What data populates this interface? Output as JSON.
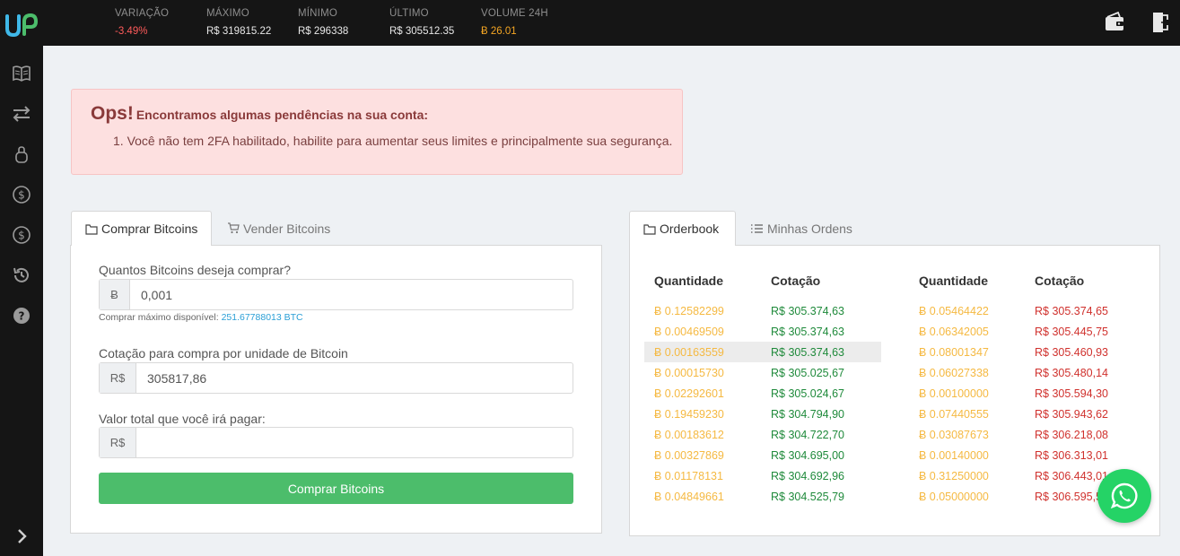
{
  "header": {
    "stats": [
      {
        "label": "VARIAÇÃO",
        "value": "-3.49%",
        "tone": "red"
      },
      {
        "label": "MÁXIMO",
        "value": "R$ 319815.22",
        "tone": "white"
      },
      {
        "label": "MÍNIMO",
        "value": "R$ 296338",
        "tone": "white"
      },
      {
        "label": "ÚLTIMO",
        "value": "R$ 305512.35",
        "tone": "white"
      },
      {
        "label": "VOLUME 24H",
        "value": "Ƀ 26.01",
        "tone": "orange"
      }
    ],
    "icons": [
      "wallet-icon",
      "logout-icon"
    ]
  },
  "sidebar": {
    "items": [
      "book-icon",
      "transfer-icon",
      "lock-icon",
      "dollar-circle-icon",
      "dollar-circle-icon",
      "history-icon",
      "help-icon"
    ],
    "expand": "chevron-right-icon"
  },
  "alert": {
    "title": "Ops!",
    "subtitle": "Encontramos algumas pendências na sua conta:",
    "items": [
      "1. Você não tem 2FA habilitado, habilite para aumentar seus limites e principalmente sua segurança."
    ]
  },
  "trade": {
    "tabs": [
      "Comprar Bitcoins",
      "Vender Bitcoins"
    ],
    "amount_label": "Quantos Bitcoins deseja comprar?",
    "amount_addon": "Ƀ",
    "amount_value": "0,001",
    "max_label": "Comprar máximo disponível:",
    "max_value": "251.67788013 BTC",
    "price_label": "Cotação para compra por unidade de Bitcoin",
    "price_addon": "R$",
    "price_value": "305817,86",
    "total_label": "Valor total que você irá pagar:",
    "total_addon": "R$",
    "total_value": "",
    "submit": "Comprar Bitcoins"
  },
  "orderbook": {
    "tabs": [
      "Orderbook",
      "Minhas Ordens"
    ],
    "headers": [
      "Quantidade",
      "Cotação",
      "Quantidade",
      "Cotação"
    ],
    "buy": [
      [
        "Ƀ 0.12582299",
        "R$ 305.374,63"
      ],
      [
        "Ƀ 0.00469509",
        "R$ 305.374,63"
      ],
      [
        "Ƀ 0.00163559",
        "R$ 305.374,63"
      ],
      [
        "Ƀ 0.00015730",
        "R$ 305.025,67"
      ],
      [
        "Ƀ 0.02292601",
        "R$ 305.024,67"
      ],
      [
        "Ƀ 0.19459230",
        "R$ 304.794,90"
      ],
      [
        "Ƀ 0.00183612",
        "R$ 304.722,70"
      ],
      [
        "Ƀ 0.00327869",
        "R$ 304.695,00"
      ],
      [
        "Ƀ 0.01178131",
        "R$ 304.692,96"
      ],
      [
        "Ƀ 0.04849661",
        "R$ 304.525,79"
      ]
    ],
    "sell": [
      [
        "Ƀ 0.05464422",
        "R$ 305.374,65"
      ],
      [
        "Ƀ 0.06342005",
        "R$ 305.445,75"
      ],
      [
        "Ƀ 0.08001347",
        "R$ 305.460,93"
      ],
      [
        "Ƀ 0.06027338",
        "R$ 305.480,14"
      ],
      [
        "Ƀ 0.00100000",
        "R$ 305.594,30"
      ],
      [
        "Ƀ 0.07440555",
        "R$ 305.943,62"
      ],
      [
        "Ƀ 0.03087673",
        "R$ 306.218,08"
      ],
      [
        "Ƀ 0.00140000",
        "R$ 306.313,01"
      ],
      [
        "Ƀ 0.31250000",
        "R$ 306.443,01"
      ],
      [
        "Ƀ 0.05000000",
        "R$ 306.595,5"
      ]
    ],
    "highlighted_buy_row": 3
  },
  "colors": {
    "topbar": "#151515",
    "alert_bg": "#fde0e0",
    "buy_button": "#4cbd6b",
    "qty": "#f5b942",
    "buy_price": "#1f8a3b",
    "sell_price": "#d0312d",
    "whatsapp": "#25d366"
  }
}
